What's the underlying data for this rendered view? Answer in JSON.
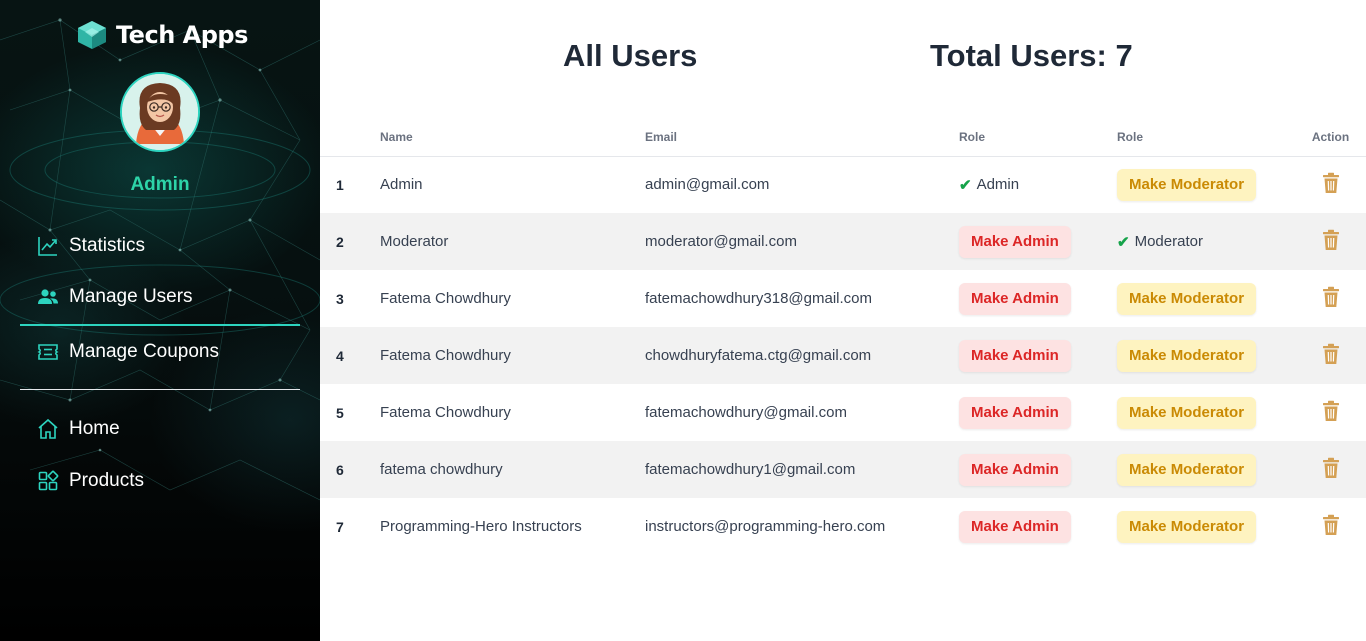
{
  "brand": {
    "name": "Tech Apps"
  },
  "profile": {
    "name": "Admin"
  },
  "nav": {
    "statistics": "Statistics",
    "manage_users": "Manage Users",
    "manage_coupons": "Manage Coupons",
    "home": "Home",
    "products": "Products"
  },
  "page": {
    "title": "All Users",
    "total_label": "Total Users: 7"
  },
  "table": {
    "headers": {
      "index": "",
      "name": "Name",
      "email": "Email",
      "role_admin": "Role",
      "role_moderator": "Role",
      "action": "Action"
    },
    "make_admin_label": "Make Admin",
    "make_moderator_label": "Make Moderator",
    "rows": [
      {
        "index": "1",
        "name": "Admin",
        "email": "admin@gmail.com",
        "admin_col": "Admin",
        "mod_col": "Make Moderator"
      },
      {
        "index": "2",
        "name": "Moderator",
        "email": "moderator@gmail.com",
        "admin_col": "Make Admin",
        "mod_col": "Moderator"
      },
      {
        "index": "3",
        "name": "Fatema Chowdhury",
        "email": "fatemachowdhury318@gmail.com",
        "admin_col": "Make Admin",
        "mod_col": "Make Moderator"
      },
      {
        "index": "4",
        "name": "Fatema Chowdhury",
        "email": "chowdhuryfatema.ctg@gmail.com",
        "admin_col": "Make Admin",
        "mod_col": "Make Moderator"
      },
      {
        "index": "5",
        "name": "Fatema Chowdhury",
        "email": "fatemachowdhury@gmail.com",
        "admin_col": "Make Admin",
        "mod_col": "Make Moderator"
      },
      {
        "index": "6",
        "name": "fatema chowdhury",
        "email": "fatemachowdhury1@gmail.com",
        "admin_col": "Make Admin",
        "mod_col": "Make Moderator"
      },
      {
        "index": "7",
        "name": "Programming-Hero Instructors",
        "email": "instructors@programming-hero.com",
        "admin_col": "Make Admin",
        "mod_col": "Make Moderator"
      }
    ]
  },
  "colors": {
    "accent": "#2dd4bf",
    "make_admin_bg": "#fde2e2",
    "make_admin_text": "#dc2626",
    "make_moderator_bg": "#fef3c0",
    "make_moderator_text": "#ca8a04",
    "trash": "#d4a054",
    "check": "#16a34a"
  },
  "icons": {
    "brand": "cube-logo-icon",
    "statistics": "chart-line-icon",
    "manage_users": "users-icon",
    "manage_coupons": "ticket-icon",
    "home": "home-icon",
    "products": "grid-icon",
    "delete": "trash-icon",
    "role_check": "checkmark-icon"
  }
}
